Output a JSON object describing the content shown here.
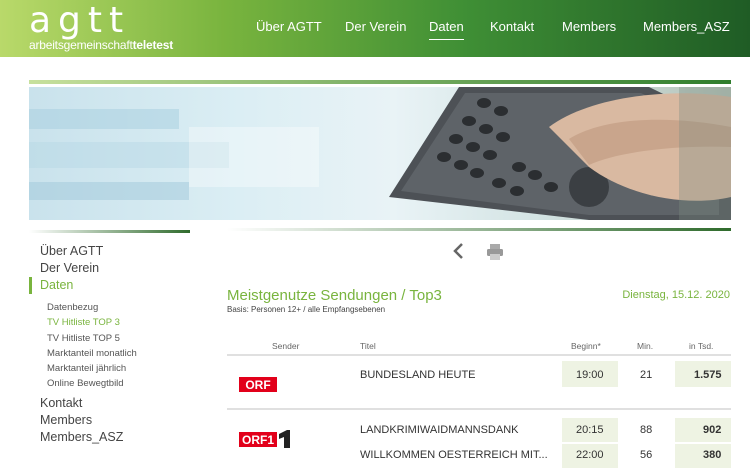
{
  "brand": {
    "logo_text": "agtt",
    "subtitle_normal": "arbeitsgemeinschaft",
    "subtitle_bold": "teletest"
  },
  "topnav": [
    "Über AGTT",
    "Der Verein",
    "Daten",
    "Kontakt",
    "Members",
    "Members_ASZ"
  ],
  "sidenav": {
    "top": [
      "Über AGTT",
      "Der Verein"
    ],
    "active": "Daten",
    "sub": [
      "Datenbezug",
      "TV Hitliste TOP 3",
      "TV Hitliste TOP 5",
      "Marktanteil monatlich",
      "Marktanteil jährlich",
      "Online Bewegtbild"
    ],
    "bottom": [
      "Kontakt",
      "Members",
      "Members_ASZ"
    ]
  },
  "content": {
    "title": "Meistgenutze Sendungen / Top3",
    "basis": "Basis: Personen 12+ / alle Empfangsebenen",
    "date": "Dienstag, 15.12. 2020"
  },
  "table": {
    "headers": {
      "sender": "Sender",
      "titel": "Titel",
      "beginn": "Beginn*",
      "min": "Min.",
      "tsd": "in Tsd."
    },
    "rows": [
      {
        "sender": "ORF",
        "title": "BUNDESLAND HEUTE",
        "begin": "19:00",
        "min": "21",
        "tsd": "1.575"
      },
      {
        "sender": "ORF1",
        "title": "LANDKRIMIWAIDMANNSDANK",
        "begin": "20:15",
        "min": "88",
        "tsd": "902"
      },
      {
        "sender": "ORF1",
        "title": "WILLKOMMEN OESTERREICH MIT...",
        "begin": "22:00",
        "min": "56",
        "tsd": "380"
      }
    ]
  },
  "colors": {
    "accent": "#79b43e",
    "orf_red": "#e2001a",
    "header_dark": "#1f5c25"
  },
  "icons": [
    "back-chevron-icon",
    "print-icon"
  ]
}
